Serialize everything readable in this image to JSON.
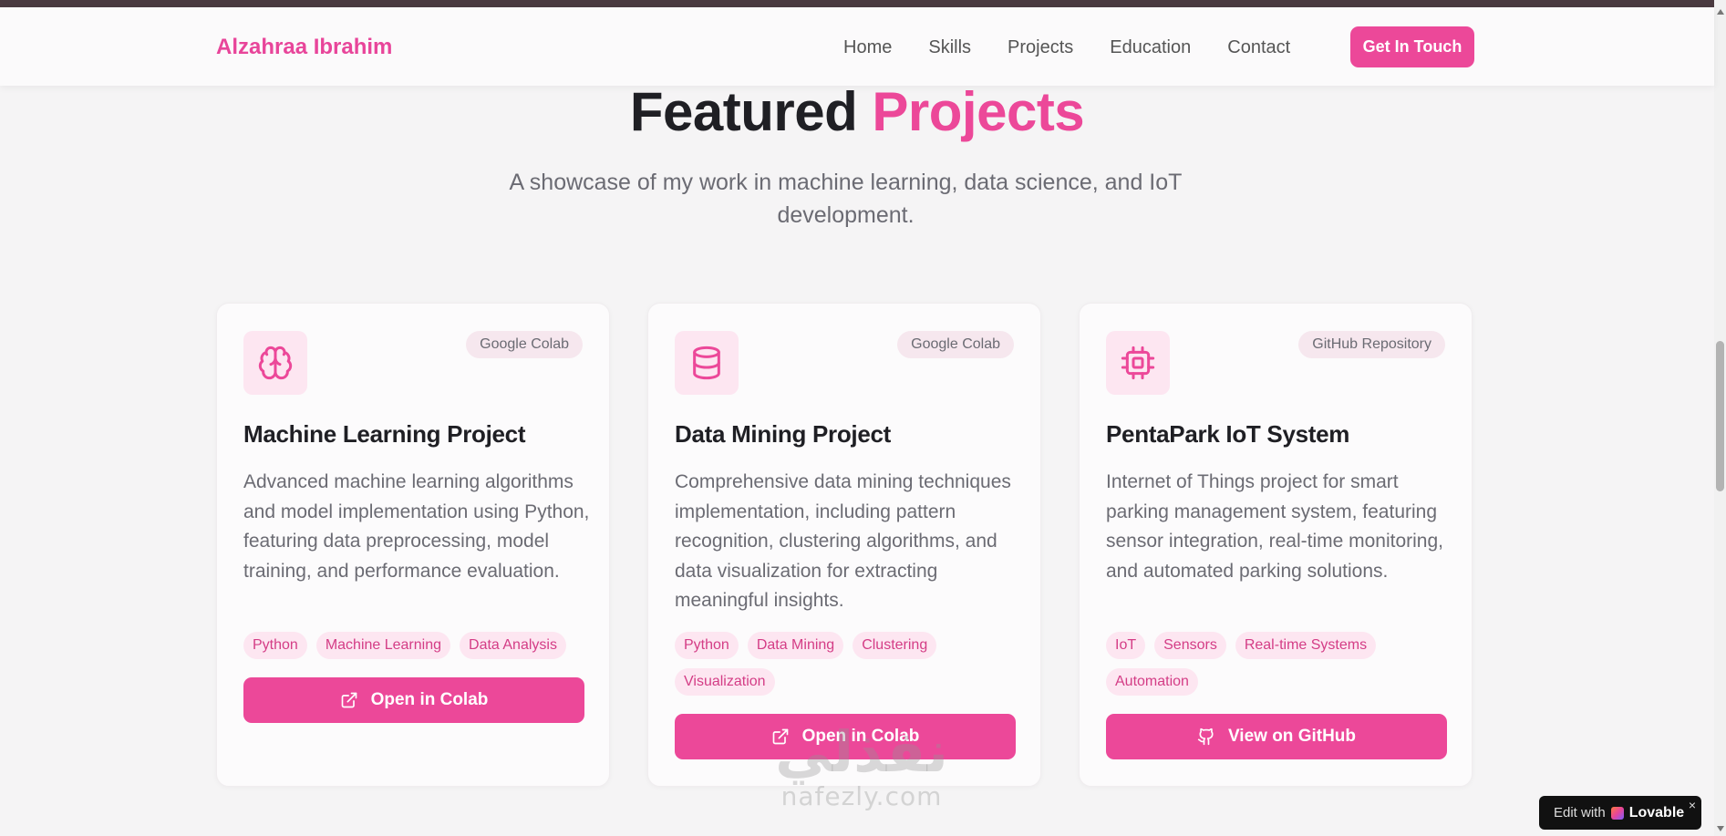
{
  "nav": {
    "brand": "Alzahraa Ibrahim",
    "links": [
      "Home",
      "Skills",
      "Projects",
      "Education",
      "Contact"
    ],
    "cta": "Get In Touch"
  },
  "section": {
    "title_main": "Featured",
    "title_accent": "Projects",
    "subtitle": "A showcase of my work in machine learning, data science, and IoT development."
  },
  "projects": [
    {
      "icon": "brain-icon",
      "badge": "Google Colab",
      "title": "Machine Learning Project",
      "description": "Advanced machine learning algorithms and model implementation using Python, featuring data preprocessing, model training, and performance evaluation.",
      "tags": [
        "Python",
        "Machine Learning",
        "Data Analysis"
      ],
      "button_icon": "external-link-icon",
      "button": "Open in Colab"
    },
    {
      "icon": "database-icon",
      "badge": "Google Colab",
      "title": "Data Mining Project",
      "description": "Comprehensive data mining techniques implementation, including pattern recognition, clustering algorithms, and data visualization for extracting meaningful insights.",
      "tags": [
        "Python",
        "Data Mining",
        "Clustering",
        "Visualization"
      ],
      "button_icon": "external-link-icon",
      "button": "Open in Colab"
    },
    {
      "icon": "cpu-icon",
      "badge": "GitHub Repository",
      "title": "PentaPark IoT System",
      "description": "Internet of Things project for smart parking management system, featuring sensor integration, real-time monitoring, and automated parking solutions.",
      "tags": [
        "IoT",
        "Sensors",
        "Real-time Systems",
        "Automation"
      ],
      "button_icon": "github-icon",
      "button": "View on GitHub"
    }
  ],
  "watermark": {
    "arabic": "نفذلي",
    "latin": "nafezly.com"
  },
  "lovable_badge": {
    "edit": "Edit with",
    "name": "Lovable",
    "close": "×"
  },
  "colors": {
    "accent": "#ec4899",
    "tag_bg": "#fde6f1",
    "text_muted": "#6b6b73"
  }
}
